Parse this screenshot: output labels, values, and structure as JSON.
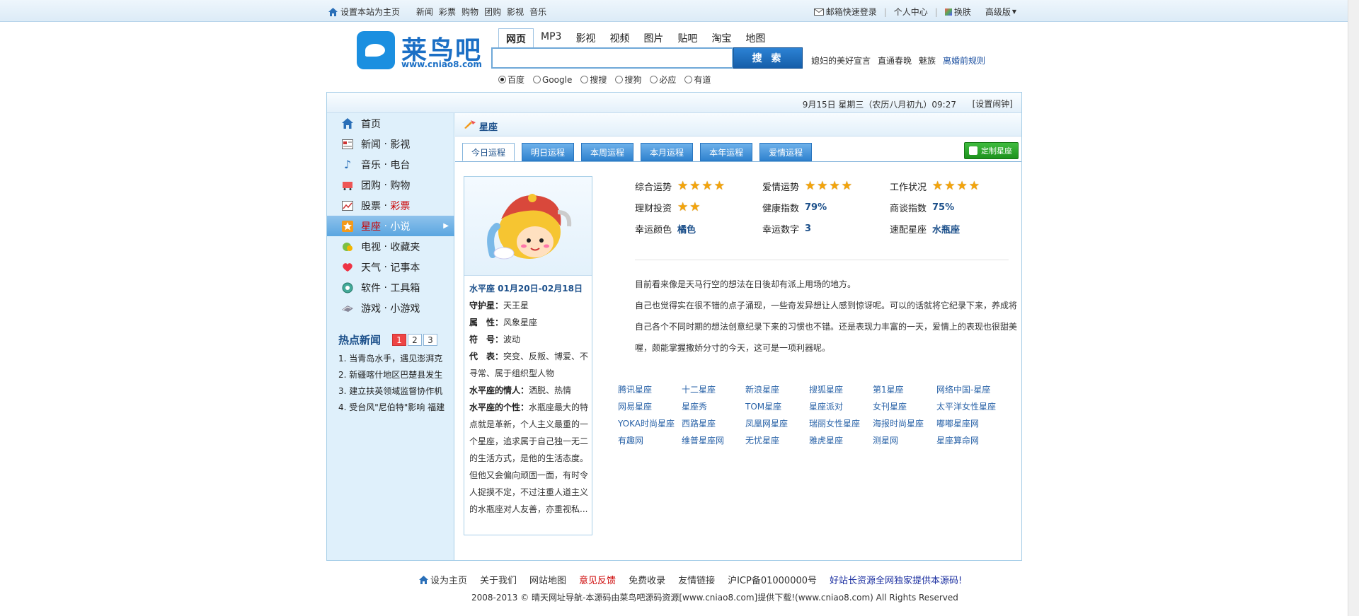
{
  "topbar": {
    "home": "设置本站为主页",
    "nav": [
      "新闻",
      "彩票",
      "购物",
      "团购",
      "影视",
      "音乐"
    ],
    "email_login": "邮箱快速登录",
    "profile": "个人中心",
    "skin": "换肤",
    "advanced": "高级版"
  },
  "logo": {
    "name": "莱鸟吧",
    "url": "www.cniao8.com"
  },
  "search": {
    "tabs": [
      "网页",
      "MP3",
      "影视",
      "视频",
      "图片",
      "贴吧",
      "淘宝",
      "地图"
    ],
    "button": "搜 索",
    "value": "",
    "engines": [
      "百度",
      "Google",
      "搜搜",
      "搜狗",
      "必应",
      "有道"
    ],
    "hot_links": [
      "媳妇的美好宣言",
      "直通春晚",
      "魅族",
      "离婚前规则"
    ]
  },
  "datebar": {
    "date": "9月15日 星期三（农历八月初九）09:27",
    "alarm": "[设置闹钟]"
  },
  "sidebar": {
    "items": [
      {
        "a": "首页",
        "b": "",
        "icon": "home-icon"
      },
      {
        "a": "新闻",
        "b": "影视",
        "icon": "news-icon"
      },
      {
        "a": "音乐",
        "b": "电台",
        "icon": "music-icon"
      },
      {
        "a": "团购",
        "b": "购物",
        "icon": "shopping-icon"
      },
      {
        "a": "股票",
        "b": "彩票",
        "icon": "stock-icon"
      },
      {
        "a": "星座",
        "b": "小说",
        "icon": "zodiac-icon"
      },
      {
        "a": "电视",
        "b": "收藏夹",
        "icon": "tv-icon"
      },
      {
        "a": "天气",
        "b": "记事本",
        "icon": "weather-icon"
      },
      {
        "a": "软件",
        "b": "工具箱",
        "icon": "software-icon"
      },
      {
        "a": "游戏",
        "b": "小游戏",
        "icon": "game-icon"
      }
    ],
    "hotnews_title": "热点新闻",
    "pages": [
      "1",
      "2",
      "3"
    ],
    "news": [
      "1. 当青岛水手，遇见澎湃克",
      "2. 新疆喀什地区巴楚县发生",
      "3. 建立扶英领域监督协作机",
      "4. 受台风\"尼伯特\"影响 福建"
    ]
  },
  "content": {
    "title": "星座",
    "tabs": [
      "今日运程",
      "明日运程",
      "本周运程",
      "本月运程",
      "本年运程",
      "爱情运程"
    ],
    "custom_button": "定制星座",
    "zodiac": {
      "heading": "水平座 01月20日-02月18日",
      "guardian_label": "守护星：",
      "guardian": "天王星",
      "attr_label": "属　性：",
      "attr": "风象星座",
      "symbol_label": "符　号：",
      "symbol": "波动",
      "rep_label": "代　表：",
      "rep": "突变、反叛、博爱、不寻常、属于组织型人物",
      "lover_label": "水平座的情人：",
      "lover": "洒脱、热情",
      "personality_label": "水平座的个性：",
      "personality": "水瓶座最大的特点就是革新，个人主义最重的一个星座，追求属于自己独一无二的生活方式，是他的生活态度。但他又会偏向顽固一面，有时令人捉摸不定，不过注重人道主义的水瓶座对人友善，亦重视私..."
    },
    "fortune": [
      {
        "label": "综合运势",
        "stars": 4
      },
      {
        "label": "爱情运势",
        "stars": 4
      },
      {
        "label": "工作状况",
        "stars": 4
      },
      {
        "label": "理财投资",
        "stars": 2
      },
      {
        "label": "健康指数",
        "value": "79%"
      },
      {
        "label": "商谈指数",
        "value": "75%"
      },
      {
        "label": "幸运颜色",
        "value": "橘色"
      },
      {
        "label": "幸运数字",
        "value": "3"
      },
      {
        "label": "速配星座",
        "value": "水瓶座"
      }
    ],
    "desc": [
      "目前看来像是天马行空的想法在日後却有派上用场的地方。",
      "自己也觉得实在很不错的点子涌现，一些奇发异想让人感到惊讶呢。可以的话就将它纪录下来，养成将自己各个不同时期的想法创意纪录下来的习惯也不错。还是表现力丰富的一天，爱情上的表现也很甜美喔，颇能掌握撒娇分寸的今天，这可是一项利器呢。"
    ],
    "links": [
      "腾讯星座",
      "十二星座",
      "新浪星座",
      "搜狐星座",
      "第1星座",
      "网络中国-星座",
      "网易星座",
      "星座秀",
      "TOM星座",
      "星座派对",
      "女刊星座",
      "太平洋女性星座",
      "YOKA时尚星座",
      "西路星座",
      "凤凰网星座",
      "瑞丽女性星座",
      "海报时尚星座",
      "嘟嘟星座网",
      "有趣网",
      "维普星座网",
      "无忧星座",
      "雅虎星座",
      "测星网",
      "星座算命网"
    ]
  },
  "footer": {
    "links": [
      "设为主页",
      "关于我们",
      "网站地图",
      "意见反馈",
      "免费收录",
      "友情链接",
      "沪ICP备01000000号",
      "好站长资源全网独家提供本源码!"
    ],
    "copyright": "2008-2013 © 晴天网址导航-本源码由莱鸟吧源码资源[www.cniao8.com]提供下载!(www.cniao8.com) All Rights Reserved"
  }
}
